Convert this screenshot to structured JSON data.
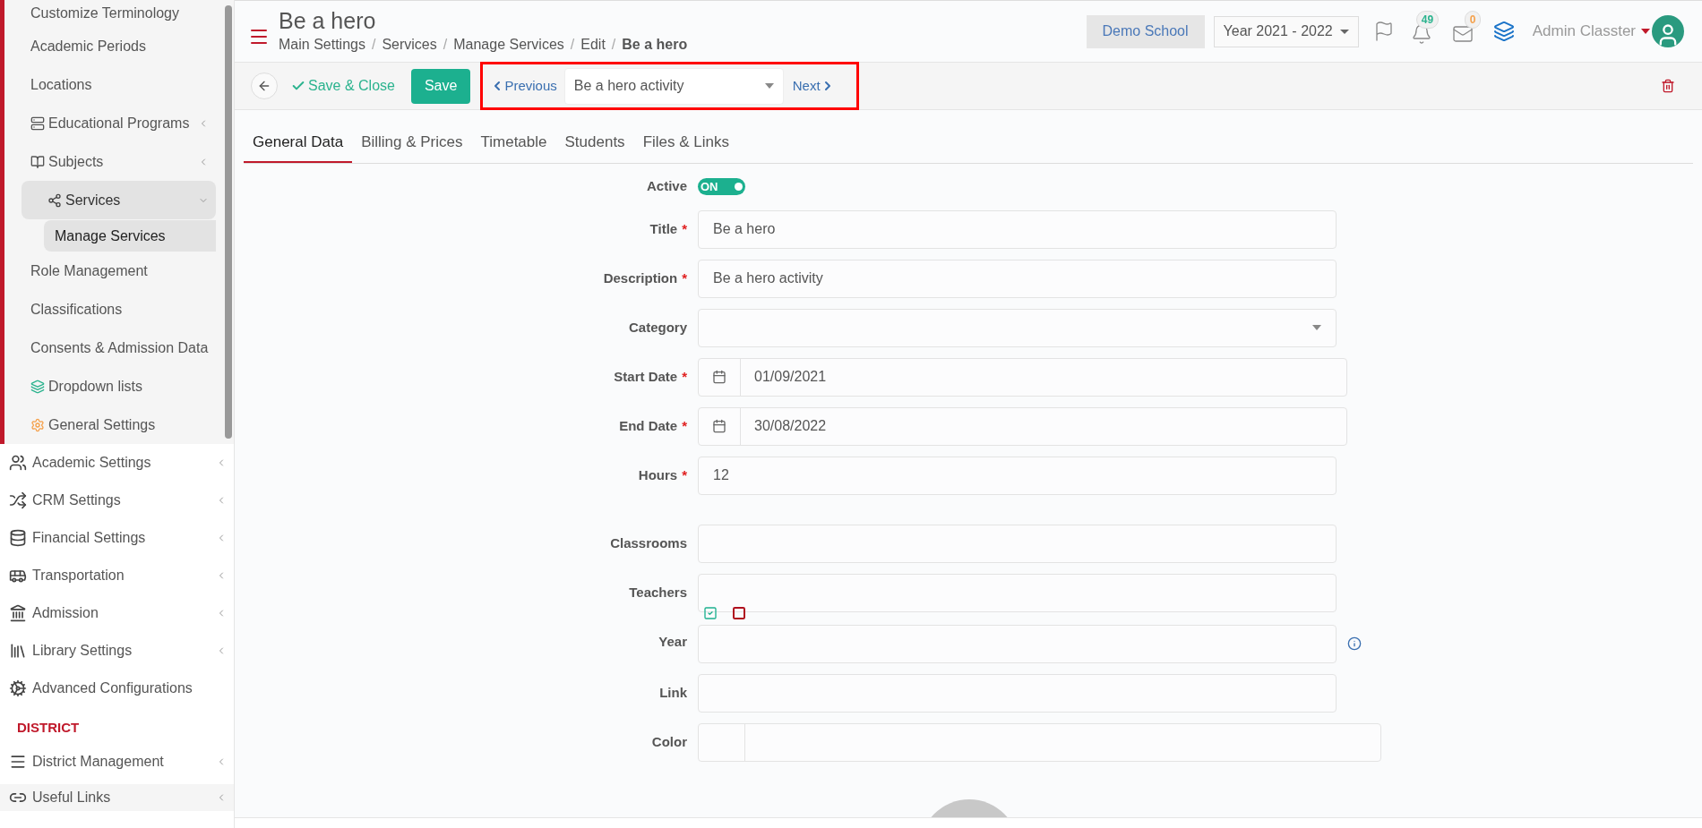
{
  "sidebar": {
    "settings_items": [
      {
        "label": "Customize Terminology",
        "expandable": false,
        "expanded": false,
        "selected": false
      },
      {
        "label": "Academic Periods",
        "expandable": false,
        "expanded": false,
        "selected": false
      },
      {
        "label": "Locations",
        "expandable": false,
        "expanded": false,
        "selected": false
      },
      {
        "label": "Educational Programs",
        "expandable": true,
        "expanded": false,
        "selected": false
      },
      {
        "label": "Subjects",
        "expandable": true,
        "expanded": false,
        "selected": false
      },
      {
        "label": "Services",
        "expandable": true,
        "expanded": true,
        "selected": false,
        "children": [
          {
            "label": "Manage Services",
            "selected": true
          }
        ]
      },
      {
        "label": "Role Management",
        "expandable": false,
        "expanded": false,
        "selected": false
      },
      {
        "label": "Classifications",
        "expandable": false,
        "expanded": false,
        "selected": false
      },
      {
        "label": "Consents & Admission Data",
        "expandable": false,
        "expanded": false,
        "selected": false
      },
      {
        "label": "Dropdown lists",
        "expandable": false,
        "expanded": false,
        "selected": false
      },
      {
        "label": "General Settings",
        "expandable": false,
        "expanded": false,
        "selected": false
      }
    ],
    "main_items": [
      {
        "label": "Academic Settings",
        "expandable": true
      },
      {
        "label": "CRM Settings",
        "expandable": true
      },
      {
        "label": "Financial Settings",
        "expandable": true
      },
      {
        "label": "Transportation",
        "expandable": true
      },
      {
        "label": "Admission",
        "expandable": true
      },
      {
        "label": "Library Settings",
        "expandable": true
      },
      {
        "label": "Advanced Configurations",
        "expandable": false
      }
    ],
    "district_heading": "DISTRICT",
    "district_items": [
      {
        "label": "District Management",
        "expandable": true
      }
    ],
    "footer_items": [
      {
        "label": "Useful Links",
        "expandable": true
      }
    ]
  },
  "header": {
    "title": "Be a hero",
    "breadcrumb_separator": "/",
    "breadcrumb": [
      "Main Settings",
      "Services",
      "Manage Services",
      "Edit",
      "Be a hero"
    ],
    "school": "Demo School",
    "year": "Year 2021 - 2022",
    "notifications": "49",
    "messages": "0",
    "user": "Admin Classter"
  },
  "toolbar": {
    "save_close": "Save & Close",
    "save": "Save",
    "previous": "Previous",
    "record": "Be a hero activity",
    "next": "Next"
  },
  "tabs": [
    {
      "label": "General Data",
      "selected": true
    },
    {
      "label": "Billing & Prices",
      "selected": false
    },
    {
      "label": "Timetable",
      "selected": false
    },
    {
      "label": "Students",
      "selected": false
    },
    {
      "label": "Files & Links",
      "selected": false
    }
  ],
  "active": {
    "label": "Active",
    "on": true,
    "text": "ON"
  },
  "required_mark": "*",
  "fields": [
    {
      "kind": "text",
      "label": "Title",
      "required": true,
      "value": "Be a hero"
    },
    {
      "kind": "text",
      "label": "Description",
      "required": true,
      "value": "Be a hero activity"
    },
    {
      "kind": "select",
      "label": "Category",
      "required": false
    },
    {
      "kind": "date",
      "label": "Start Date",
      "required": true,
      "value": "01/09/2021"
    },
    {
      "kind": "date",
      "label": "End Date",
      "required": true,
      "value": "30/08/2022"
    },
    {
      "kind": "text",
      "label": "Hours",
      "required": true,
      "value": "12"
    },
    {
      "kind": "spacer"
    },
    {
      "kind": "text",
      "label": "Classrooms",
      "required": false
    },
    {
      "kind": "text",
      "label": "Teachers",
      "required": false
    },
    {
      "kind": "year",
      "label": "Year",
      "required": false
    },
    {
      "kind": "text",
      "label": "Link",
      "required": false
    },
    {
      "kind": "color",
      "label": "Color",
      "required": false
    }
  ]
}
